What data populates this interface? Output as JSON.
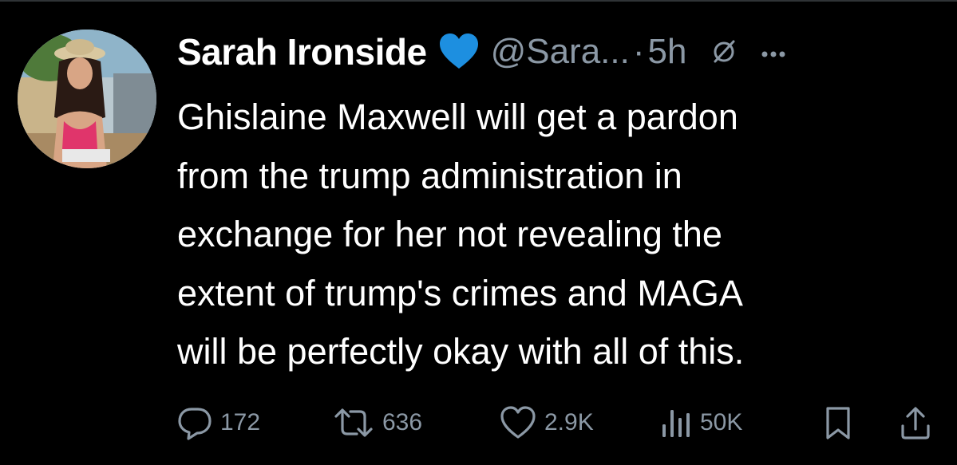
{
  "colors": {
    "background": "#000000",
    "text": "#ffffff",
    "muted": "#8b98a5",
    "heart": "#1d8fe0"
  },
  "tweet": {
    "display_name": "Sarah Ironside",
    "name_emoji": "blue-heart",
    "handle": "@Sara...",
    "separator": "·",
    "time": "5h",
    "text": "Ghislaine Maxwell will get a pardon\nfrom the trump administration in\nexchange for her not revealing the\nextent of trump's crimes and MAGA\nwill be perfectly okay with all of this."
  },
  "actions": {
    "reply_count": "172",
    "retweet_count": "636",
    "like_count": "2.9K",
    "views_count": "50K"
  },
  "icons": [
    "avatar",
    "blue-heart-emoji",
    "grok-icon",
    "more-icon",
    "reply-icon",
    "retweet-icon",
    "like-icon",
    "views-icon",
    "bookmark-icon",
    "share-icon"
  ]
}
